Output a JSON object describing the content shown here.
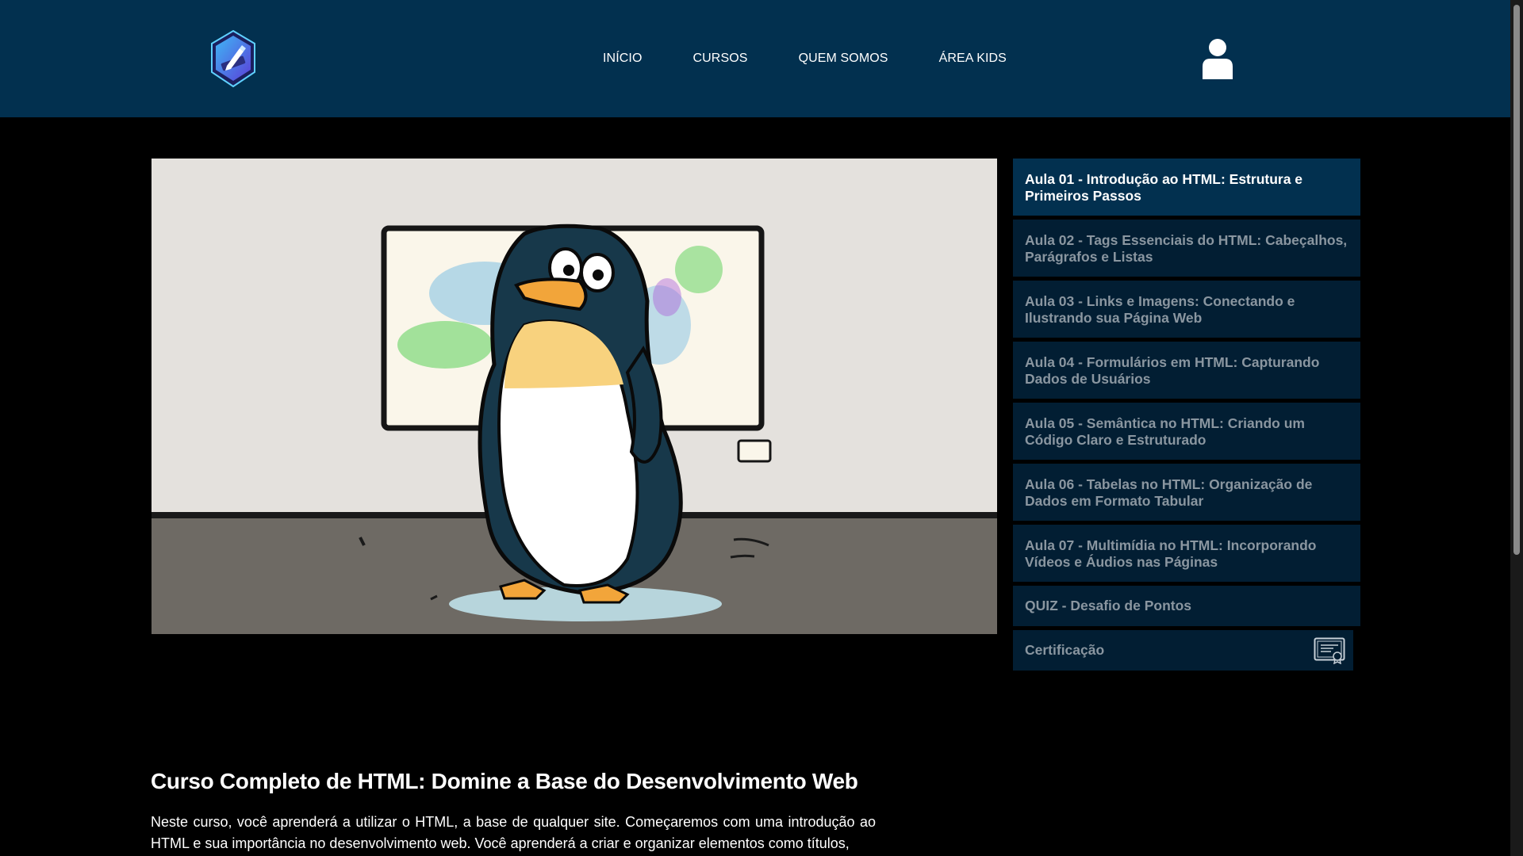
{
  "header": {
    "nav": [
      "INÍCIO",
      "CURSOS",
      "QUEM SOMOS",
      "ÁREA KIDS"
    ]
  },
  "lessons": [
    "Aula 01 - Introdução ao HTML: Estrutura e Primeiros Passos",
    "Aula 02 - Tags Essenciais do HTML: Cabeçalhos, Parágrafos e Listas",
    "Aula 03 - Links e Imagens: Conectando e Ilustrando sua Página Web",
    "Aula 04 - Formulários em HTML: Capturando Dados de Usuários",
    "Aula 05 - Semântica no HTML: Criando um Código Claro e Estruturado",
    "Aula 06 - Tabelas no HTML: Organização de Dados em Formato Tabular",
    "Aula 07 - Multimídia no HTML: Incorporando Vídeos e Áudios nas Páginas"
  ],
  "quiz_label": "QUIZ - Desafio de Pontos",
  "cert_label": "Certificação",
  "course": {
    "title": "Curso Completo de HTML: Domine a Base do Desenvolvimento Web",
    "description": "Neste curso, você aprenderá a utilizar o HTML, a base de qualquer site. Começaremos com uma introdução ao HTML e sua importância no desenvolvimento web. Você aprenderá a criar e organizar elementos como títulos,"
  },
  "colors": {
    "header_bg": "#02304f",
    "active_lesson_bg": "#02304f",
    "lesson_bg": "#021e33",
    "page_bg": "#000000"
  },
  "icons": {
    "logo": "hexagon-pen-logo",
    "user": "user-icon",
    "certificate": "certificate-icon"
  }
}
